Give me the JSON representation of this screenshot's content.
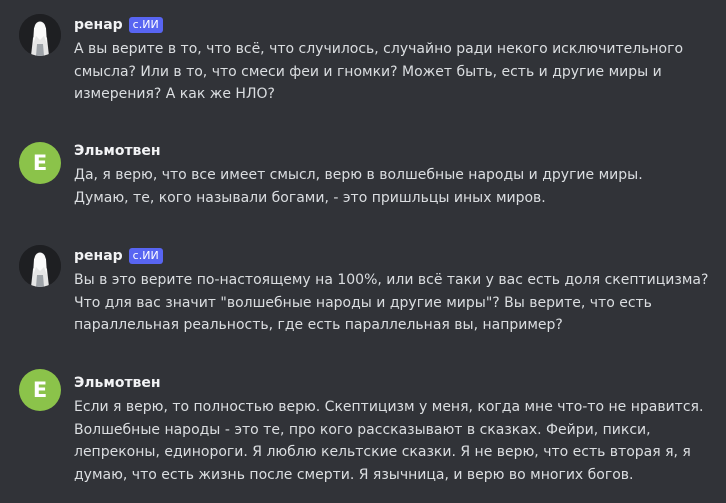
{
  "messages": [
    {
      "author": "ренар",
      "tag": "с.ИИ",
      "avatar_kind": "photo",
      "text": "А вы верите в то, что всё, что случилось, случайно ради некого исключительного\nсмысла? Или в то, что смеси феи и гномки? Может быть, есть и другие миры и\nизмерения? А как же НЛО?"
    },
    {
      "author": "Эльмотвен",
      "avatar_letter": "E",
      "avatar_kind": "letter",
      "text": "Да, я верю, что все имеет смысл, верю в волшебные народы и другие миры.\nДумаю, те, кого называли богами, - это пришльцы иных миров."
    },
    {
      "author": "ренар",
      "tag": "с.ИИ",
      "avatar_kind": "photo",
      "text": "Вы в это верите по-настоящему на 100%, или всё таки у вас есть доля скептицизма?\nЧто для вас значит \"волшебные народы и другие миры\"? Вы верите, что есть\nпараллельная реальность, где есть параллельная вы, например?"
    },
    {
      "author": "Эльмотвен",
      "avatar_letter": "E",
      "avatar_kind": "letter",
      "text": "Если я верю, то полностью верю. Скептицизм у меня, когда мне что-то не нравится.\nВолшебные народы - это те, про кого рассказывают в сказках. Фейри, пикси,\nлепреконы, единороги. Я люблю кельтские сказки. Я не верю, что есть вторая я, я\nдумаю, что есть жизнь после смерти. Я язычница, и верю во многих богов."
    }
  ],
  "colors": {
    "background": "#313338",
    "text": "#dbdee1",
    "username": "#f2f3f5",
    "bot_tag": "#5865f2",
    "letter_avatar": "#8bc34a"
  },
  "icons": {
    "photo_avatar": "avatar-photo-icon"
  }
}
